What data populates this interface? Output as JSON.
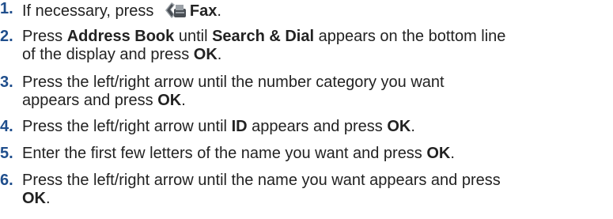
{
  "steps": [
    {
      "number": "1.",
      "parts": [
        "If necessary, press ",
        "Fax",
        "."
      ],
      "icon": "fax-icon"
    },
    {
      "number": "2.",
      "parts": [
        "Press ",
        "Address Book",
        " until ",
        "Search & Dial",
        " appears on the bottom line",
        "of the display and press ",
        "OK",
        "."
      ]
    },
    {
      "number": "3.",
      "parts": [
        "Press the left/right arrow until the number category you want",
        "appears and press ",
        "OK",
        "."
      ]
    },
    {
      "number": "4.",
      "parts": [
        "Press the left/right arrow until ",
        "ID",
        " appears and press ",
        "OK",
        "."
      ]
    },
    {
      "number": "5.",
      "parts": [
        "Enter the first few letters of the name you want and press ",
        "OK",
        "."
      ]
    },
    {
      "number": "6.",
      "parts": [
        "Press the left/right arrow until the name you want appears and press",
        "OK",
        "."
      ]
    }
  ],
  "colors": {
    "number": "#1f4e8c",
    "text": "#222222",
    "icon_gray": "#9aa0a6",
    "icon_dark": "#4a4f55"
  }
}
